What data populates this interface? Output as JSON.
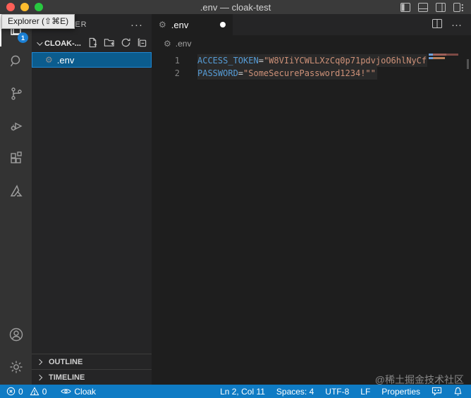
{
  "window": {
    "title": ".env — cloak-test"
  },
  "tooltip": {
    "text": "Explorer (⇧⌘E)"
  },
  "titlebar_actions": {
    "icons": [
      "toggle-sidebar-icon",
      "toggle-panel-icon",
      "toggle-secondary-sidebar-icon",
      "customize-layout-icon"
    ]
  },
  "activity_bar": {
    "badge": "1",
    "items": [
      {
        "label": "Explorer",
        "icon": "files-icon",
        "active": true
      },
      {
        "label": "Search",
        "icon": "search-icon"
      },
      {
        "label": "Source Control",
        "icon": "source-control-icon"
      },
      {
        "label": "Run and Debug",
        "icon": "run-debug-icon"
      },
      {
        "label": "Extensions",
        "icon": "extensions-icon"
      },
      {
        "label": "Azure",
        "icon": "azure-icon"
      }
    ],
    "bottom_items": [
      {
        "label": "Accounts",
        "icon": "account-icon"
      },
      {
        "label": "Settings",
        "icon": "settings-gear-icon"
      }
    ]
  },
  "sidebar": {
    "title": "EXPLORER",
    "more_glyph": "···",
    "section": {
      "label": "CLOAK-...",
      "action_icons": [
        "new-file-icon",
        "new-folder-icon",
        "refresh-icon",
        "collapse-all-icon"
      ]
    },
    "files": [
      {
        "name": ".env",
        "icon": "gear-file-icon",
        "selected": true
      }
    ],
    "panels": [
      {
        "label": "OUTLINE"
      },
      {
        "label": "TIMELINE"
      }
    ]
  },
  "editor": {
    "tab": {
      "label": ".env",
      "modified": true,
      "more_glyph": "···"
    },
    "breadcrumb": {
      "label": ".env"
    },
    "lines": [
      {
        "number": "1",
        "key": "ACCESS_TOKEN",
        "operator": "=",
        "value": "\"W8VIiYCWLLXzCq0p71pdvjoO6hlNyCf"
      },
      {
        "number": "2",
        "key": "PASSWORD",
        "operator": "=",
        "value": "\"SomeSecurePassword1234!\"\""
      }
    ]
  },
  "status_bar": {
    "errors": "0",
    "warnings": "0",
    "cloak_label": "Cloak",
    "cursor_position": "Ln 2, Col 11",
    "indentation": "Spaces: 4",
    "encoding": "UTF-8",
    "eol": "LF",
    "language_mode": "Properties"
  },
  "watermark": "@稀土掘金技术社区",
  "colors": {
    "status_bar": "#0F7BC4",
    "selection_background": "#0B5C8E",
    "selection_border": "#2087D2",
    "badge": "#1B80D4",
    "token_key": "#569CD6",
    "token_string": "#CE9178",
    "editor_background": "#1E1E1E",
    "sidebar_background": "#252526",
    "activity_bar_background": "#333333",
    "titlebar_background": "#3A3A3A"
  }
}
